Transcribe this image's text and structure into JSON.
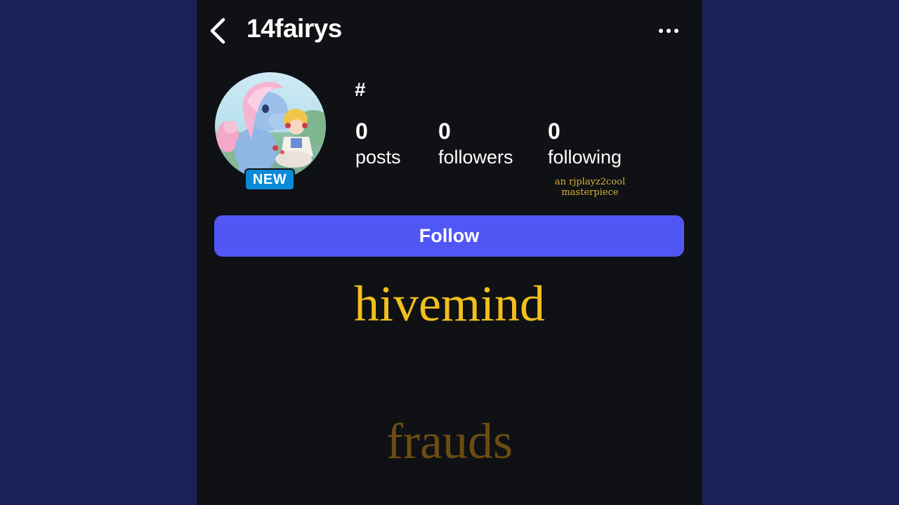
{
  "header": {
    "username": "14fairys"
  },
  "profile": {
    "display_name": "#",
    "badge": "NEW",
    "stats": [
      {
        "value": "0",
        "label": "posts"
      },
      {
        "value": "0",
        "label": "followers"
      },
      {
        "value": "0",
        "label": "following"
      }
    ]
  },
  "watermark": {
    "line1": "an rjplayz2cool",
    "line2": "masterpiece"
  },
  "actions": {
    "follow_label": "Follow"
  },
  "captions": {
    "first": "hivemind",
    "second": "frauds"
  },
  "colors": {
    "outer_background": "#1c205a",
    "screen_background": "#0f1114",
    "follow_button": "#5157f5",
    "new_badge": "#0a8ad8",
    "caption_primary": "#f2bf1c",
    "caption_secondary": "#6b4c12"
  },
  "icons": {
    "back": "chevron-left-icon",
    "more": "more-horizontal-icon"
  }
}
